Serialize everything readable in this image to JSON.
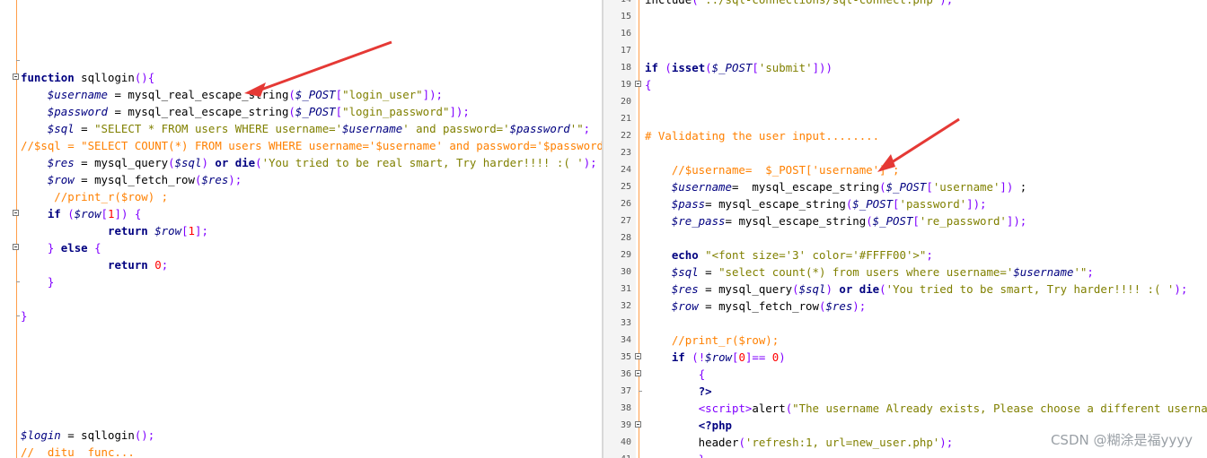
{
  "left": {
    "lines": [
      {
        "top": 0,
        "parts": [],
        "tick": true
      },
      {
        "fold": true,
        "parts": [
          [
            "k",
            "function "
          ],
          [
            "t",
            "sqllogin"
          ],
          [
            "p",
            "(){"
          ]
        ]
      },
      {
        "parts": [
          [
            "t",
            "    "
          ],
          [
            "v",
            "$username"
          ],
          [
            "t",
            " = mysql_real_escape_string"
          ],
          [
            "p",
            "("
          ],
          [
            "v",
            "$_POST"
          ],
          [
            "p",
            "["
          ],
          [
            "s",
            "\"login_user\""
          ],
          [
            "p",
            "]);"
          ]
        ]
      },
      {
        "parts": [
          [
            "t",
            "    "
          ],
          [
            "v",
            "$password"
          ],
          [
            "t",
            " = mysql_real_escape_string"
          ],
          [
            "p",
            "("
          ],
          [
            "v",
            "$_POST"
          ],
          [
            "p",
            "["
          ],
          [
            "s",
            "\"login_password\""
          ],
          [
            "p",
            "]);"
          ]
        ]
      },
      {
        "parts": [
          [
            "t",
            "    "
          ],
          [
            "v",
            "$sql"
          ],
          [
            "t",
            " = "
          ],
          [
            "s",
            "\"SELECT * FROM users WHERE username='"
          ],
          [
            "v",
            "$username"
          ],
          [
            "s",
            "' and password='"
          ],
          [
            "v",
            "$password"
          ],
          [
            "s",
            "'\""
          ],
          [
            "p",
            ";"
          ]
        ]
      },
      {
        "parts": [
          [
            "c",
            "//$sql = \"SELECT COUNT(*) FROM users WHERE username='$username' and password='$password'\""
          ]
        ]
      },
      {
        "parts": [
          [
            "t",
            "    "
          ],
          [
            "v",
            "$res"
          ],
          [
            "t",
            " = mysql_query"
          ],
          [
            "p",
            "("
          ],
          [
            "v",
            "$sql"
          ],
          [
            "p",
            ")"
          ],
          [
            "t",
            " "
          ],
          [
            "k",
            "or"
          ],
          [
            "t",
            " "
          ],
          [
            "k",
            "die"
          ],
          [
            "p",
            "("
          ],
          [
            "s",
            "'You tried to be real smart, Try harder!!!! :( '"
          ],
          [
            "p",
            ");"
          ]
        ]
      },
      {
        "parts": [
          [
            "t",
            "    "
          ],
          [
            "v",
            "$row"
          ],
          [
            "t",
            " = mysql_fetch_row"
          ],
          [
            "p",
            "("
          ],
          [
            "v",
            "$res"
          ],
          [
            "p",
            ");"
          ]
        ]
      },
      {
        "parts": [
          [
            "c",
            "     //print_r($row) ;"
          ]
        ]
      },
      {
        "fold": true,
        "parts": [
          [
            "t",
            "    "
          ],
          [
            "k",
            "if"
          ],
          [
            "t",
            " "
          ],
          [
            "p",
            "("
          ],
          [
            "v",
            "$row"
          ],
          [
            "p",
            "["
          ],
          [
            "n",
            "1"
          ],
          [
            "p",
            "]) {"
          ]
        ]
      },
      {
        "parts": [
          [
            "t",
            "             "
          ],
          [
            "k",
            "return"
          ],
          [
            "t",
            " "
          ],
          [
            "v",
            "$row"
          ],
          [
            "p",
            "["
          ],
          [
            "n",
            "1"
          ],
          [
            "p",
            "];"
          ]
        ]
      },
      {
        "fold": true,
        "parts": [
          [
            "t",
            "    "
          ],
          [
            "p",
            "}"
          ],
          [
            "t",
            " "
          ],
          [
            "k",
            "else"
          ],
          [
            "t",
            " "
          ],
          [
            "p",
            "{"
          ]
        ]
      },
      {
        "parts": [
          [
            "t",
            "             "
          ],
          [
            "k",
            "return"
          ],
          [
            "t",
            " "
          ],
          [
            "n",
            "0"
          ],
          [
            "p",
            ";"
          ]
        ]
      },
      {
        "tick": true,
        "parts": [
          [
            "t",
            "    "
          ],
          [
            "p",
            "}"
          ]
        ]
      },
      {
        "parts": []
      },
      {
        "tick": true,
        "parts": [
          [
            "p",
            "}"
          ]
        ]
      },
      {
        "parts": []
      },
      {
        "parts": []
      },
      {
        "parts": []
      },
      {
        "parts": []
      },
      {
        "parts": []
      },
      {
        "parts": []
      },
      {
        "parts": [
          [
            "v",
            "$login"
          ],
          [
            "t",
            " = sqllogin"
          ],
          [
            "p",
            "();"
          ]
        ]
      },
      {
        "parts": [
          [
            "c",
            "//  ditu  func..."
          ]
        ]
      }
    ]
  },
  "right": {
    "lines": [
      {
        "num": "14",
        "parts": [
          [
            "t",
            "include"
          ],
          [
            "p",
            "("
          ],
          [
            "s",
            "'../sql-connections/sql-connect.php'"
          ],
          [
            "p",
            ");"
          ]
        ]
      },
      {
        "num": "15",
        "parts": []
      },
      {
        "num": "16",
        "parts": []
      },
      {
        "num": "17",
        "parts": []
      },
      {
        "num": "18",
        "parts": [
          [
            "k",
            "if"
          ],
          [
            "t",
            " "
          ],
          [
            "p",
            "("
          ],
          [
            "k",
            "isset"
          ],
          [
            "p",
            "("
          ],
          [
            "v",
            "$_POST"
          ],
          [
            "p",
            "["
          ],
          [
            "s",
            "'submit'"
          ],
          [
            "p",
            "]))"
          ]
        ]
      },
      {
        "num": "19",
        "fold": true,
        "parts": [
          [
            "p",
            "{"
          ]
        ]
      },
      {
        "num": "20",
        "parts": []
      },
      {
        "num": "21",
        "parts": []
      },
      {
        "num": "22",
        "parts": [
          [
            "c",
            "# Validating the user input........"
          ]
        ]
      },
      {
        "num": "23",
        "parts": []
      },
      {
        "num": "24",
        "parts": [
          [
            "c",
            "    //$username=  $_POST['username'] ;"
          ]
        ]
      },
      {
        "num": "25",
        "parts": [
          [
            "t",
            "    "
          ],
          [
            "v",
            "$username"
          ],
          [
            "t",
            "=  mysql_escape_string"
          ],
          [
            "p",
            "("
          ],
          [
            "v",
            "$_POST"
          ],
          [
            "p",
            "["
          ],
          [
            "s",
            "'username'"
          ],
          [
            "p",
            "])"
          ],
          [
            "t",
            " ;"
          ]
        ]
      },
      {
        "num": "26",
        "parts": [
          [
            "t",
            "    "
          ],
          [
            "v",
            "$pass"
          ],
          [
            "t",
            "= mysql_escape_string"
          ],
          [
            "p",
            "("
          ],
          [
            "v",
            "$_POST"
          ],
          [
            "p",
            "["
          ],
          [
            "s",
            "'password'"
          ],
          [
            "p",
            "]);"
          ]
        ]
      },
      {
        "num": "27",
        "parts": [
          [
            "t",
            "    "
          ],
          [
            "v",
            "$re_pass"
          ],
          [
            "t",
            "= mysql_escape_string"
          ],
          [
            "p",
            "("
          ],
          [
            "v",
            "$_POST"
          ],
          [
            "p",
            "["
          ],
          [
            "s",
            "'re_password'"
          ],
          [
            "p",
            "]);"
          ]
        ]
      },
      {
        "num": "28",
        "parts": []
      },
      {
        "num": "29",
        "parts": [
          [
            "t",
            "    "
          ],
          [
            "k",
            "echo"
          ],
          [
            "t",
            " "
          ],
          [
            "s",
            "\"<font size='3' color='#FFFF00'>\""
          ],
          [
            "p",
            ";"
          ]
        ]
      },
      {
        "num": "30",
        "parts": [
          [
            "t",
            "    "
          ],
          [
            "v",
            "$sql"
          ],
          [
            "t",
            " = "
          ],
          [
            "s",
            "\"select count(*) from users where username='"
          ],
          [
            "v",
            "$username"
          ],
          [
            "s",
            "'\""
          ],
          [
            "p",
            ";"
          ]
        ]
      },
      {
        "num": "31",
        "parts": [
          [
            "t",
            "    "
          ],
          [
            "v",
            "$res"
          ],
          [
            "t",
            " = mysql_query"
          ],
          [
            "p",
            "("
          ],
          [
            "v",
            "$sql"
          ],
          [
            "p",
            ")"
          ],
          [
            "t",
            " "
          ],
          [
            "k",
            "or"
          ],
          [
            "t",
            " "
          ],
          [
            "k",
            "die"
          ],
          [
            "p",
            "("
          ],
          [
            "s",
            "'You tried to be smart, Try harder!!!! :( '"
          ],
          [
            "p",
            ");"
          ]
        ]
      },
      {
        "num": "32",
        "parts": [
          [
            "t",
            "    "
          ],
          [
            "v",
            "$row"
          ],
          [
            "t",
            " = mysql_fetch_row"
          ],
          [
            "p",
            "("
          ],
          [
            "v",
            "$res"
          ],
          [
            "p",
            ");"
          ]
        ]
      },
      {
        "num": "33",
        "parts": []
      },
      {
        "num": "34",
        "parts": [
          [
            "c",
            "    //print_r($row);"
          ]
        ]
      },
      {
        "num": "35",
        "fold": true,
        "parts": [
          [
            "t",
            "    "
          ],
          [
            "k",
            "if"
          ],
          [
            "t",
            " "
          ],
          [
            "p",
            "(!"
          ],
          [
            "v",
            "$row"
          ],
          [
            "p",
            "["
          ],
          [
            "n",
            "0"
          ],
          [
            "p",
            "]== "
          ],
          [
            "n",
            "0"
          ],
          [
            "p",
            ")"
          ]
        ]
      },
      {
        "num": "36",
        "fold": true,
        "parts": [
          [
            "t",
            "        "
          ],
          [
            "p",
            "{"
          ]
        ]
      },
      {
        "num": "37",
        "tick": true,
        "parts": [
          [
            "t",
            "        "
          ],
          [
            "k",
            "?>"
          ]
        ]
      },
      {
        "num": "38",
        "parts": [
          [
            "t",
            "        "
          ],
          [
            "p",
            "<script>"
          ],
          [
            "t",
            "alert"
          ],
          [
            "p",
            "("
          ],
          [
            "s",
            "\"The username Already exists, Please choose a different username \""
          ],
          [
            "p",
            ")"
          ]
        ]
      },
      {
        "num": "39",
        "fold": true,
        "parts": [
          [
            "t",
            "        "
          ],
          [
            "k",
            "<?php"
          ]
        ]
      },
      {
        "num": "40",
        "parts": [
          [
            "t",
            "        header"
          ],
          [
            "p",
            "("
          ],
          [
            "s",
            "'refresh:1, url=new_user.php'"
          ],
          [
            "p",
            ");"
          ]
        ]
      },
      {
        "num": "41",
        "parts": [
          [
            "t",
            "        "
          ],
          [
            "p",
            "}"
          ]
        ]
      }
    ]
  },
  "watermark": "CSDN @糊涂是福yyyy",
  "arrow_color": "#e53935"
}
